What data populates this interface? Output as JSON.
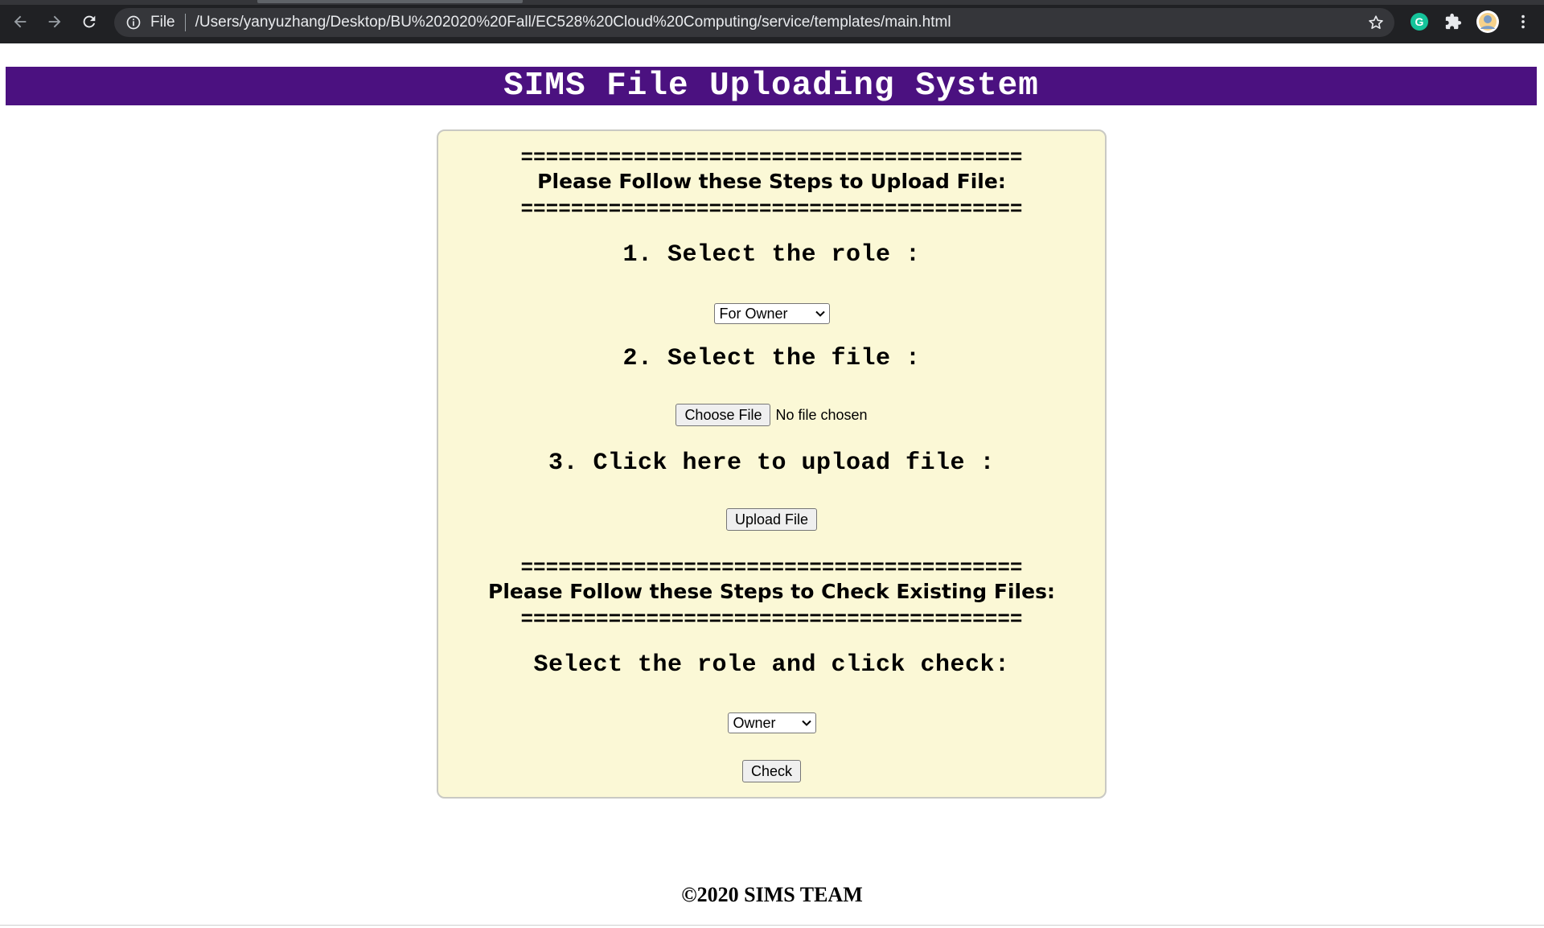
{
  "browser": {
    "scheme_label": "File",
    "url": "/Users/yanyuzhang/Desktop/BU%202020%20Fall/EC528%20Cloud%20Computing/service/templates/main.html",
    "icons": [
      "back-arrow-icon",
      "forward-arrow-icon",
      "reload-icon",
      "info-icon",
      "star-icon",
      "grammarly-extension-icon",
      "extensions-puzzle-icon",
      "profile-avatar",
      "more-menu-icon"
    ]
  },
  "banner": {
    "title": "SIMS File Uploading System"
  },
  "upload_section": {
    "separator": "========================================",
    "title": "Please Follow these Steps to Upload File:",
    "step1": "1. Select the role :",
    "role_select_value": "For Owner",
    "step2": "2. Select the file :",
    "choose_file_label": "Choose File",
    "no_file_text": "No file chosen",
    "step3": "3. Click here to upload file :",
    "upload_button_label": "Upload File"
  },
  "check_section": {
    "separator": "========================================",
    "title": "Please Follow these Steps to Check Existing Files:",
    "instruction": "Select the role and click check:",
    "role_select_value": "Owner",
    "check_button_label": "Check"
  },
  "footer": {
    "text": "©2020 SIMS TEAM"
  },
  "colors": {
    "banner_bg": "#4b1180",
    "panel_bg": "#fbf8d6",
    "chrome_bg": "#202124"
  }
}
